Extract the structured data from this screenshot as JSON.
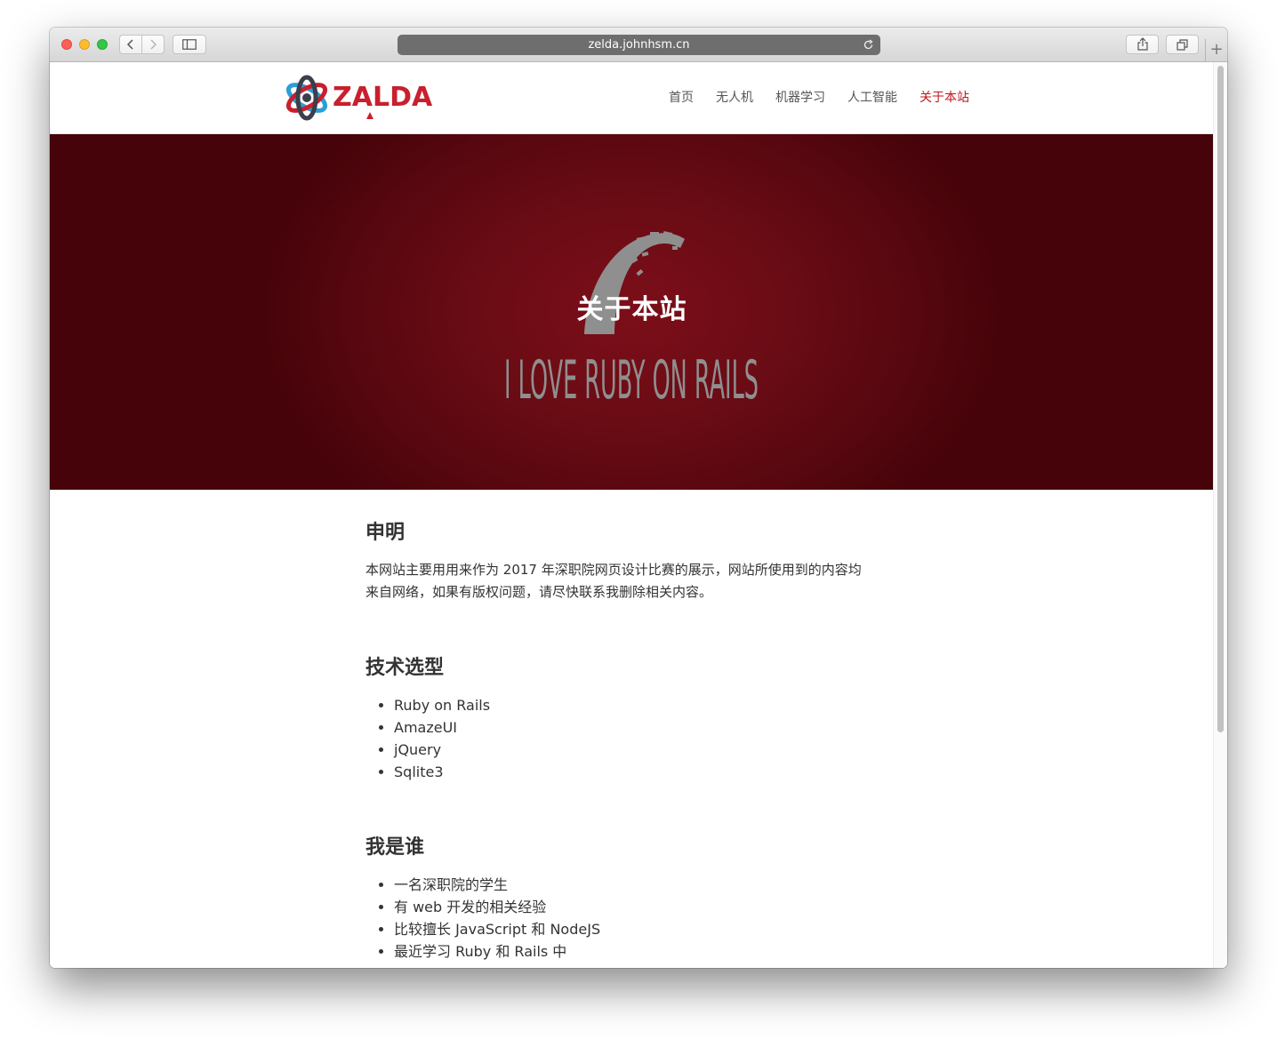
{
  "browser": {
    "url": "zelda.johnhsm.cn",
    "back_icon": "chevron-left-icon",
    "forward_icon": "chevron-right-icon",
    "sidebar_icon": "sidebar-icon",
    "share_icon": "share-icon",
    "tabs_icon": "tabs-overview-icon",
    "reload_icon": "reload-icon",
    "new_tab_icon": "plus-icon"
  },
  "site": {
    "logo_text": "ZALDA",
    "nav": [
      {
        "label": "首页"
      },
      {
        "label": "无人机"
      },
      {
        "label": "机器学习"
      },
      {
        "label": "人工智能"
      },
      {
        "label": "关于本站",
        "active": true
      }
    ],
    "accent_color": "#c4161c"
  },
  "hero": {
    "title": "关于本站",
    "banner_text": "I LOVE RUBY ON RAILS"
  },
  "sections": {
    "statement": {
      "heading": "申明",
      "line1": "本网站主要用用来作为 2017 年深职院网页设计比赛的展示，网站所使用到的内容均",
      "line2": "来自网络，如果有版权问题，请尽快联系我删除相关内容。"
    },
    "tech": {
      "heading": "技术选型",
      "items": [
        "Ruby on Rails",
        "AmazeUI",
        "jQuery",
        "Sqlite3"
      ]
    },
    "about": {
      "heading": "我是谁",
      "items": [
        "一名深职院的学生",
        "有 web 开发的相关经验",
        "比较擅长 JavaScript 和 NodeJS",
        "最近学习 Ruby 和 Rails 中"
      ]
    }
  }
}
